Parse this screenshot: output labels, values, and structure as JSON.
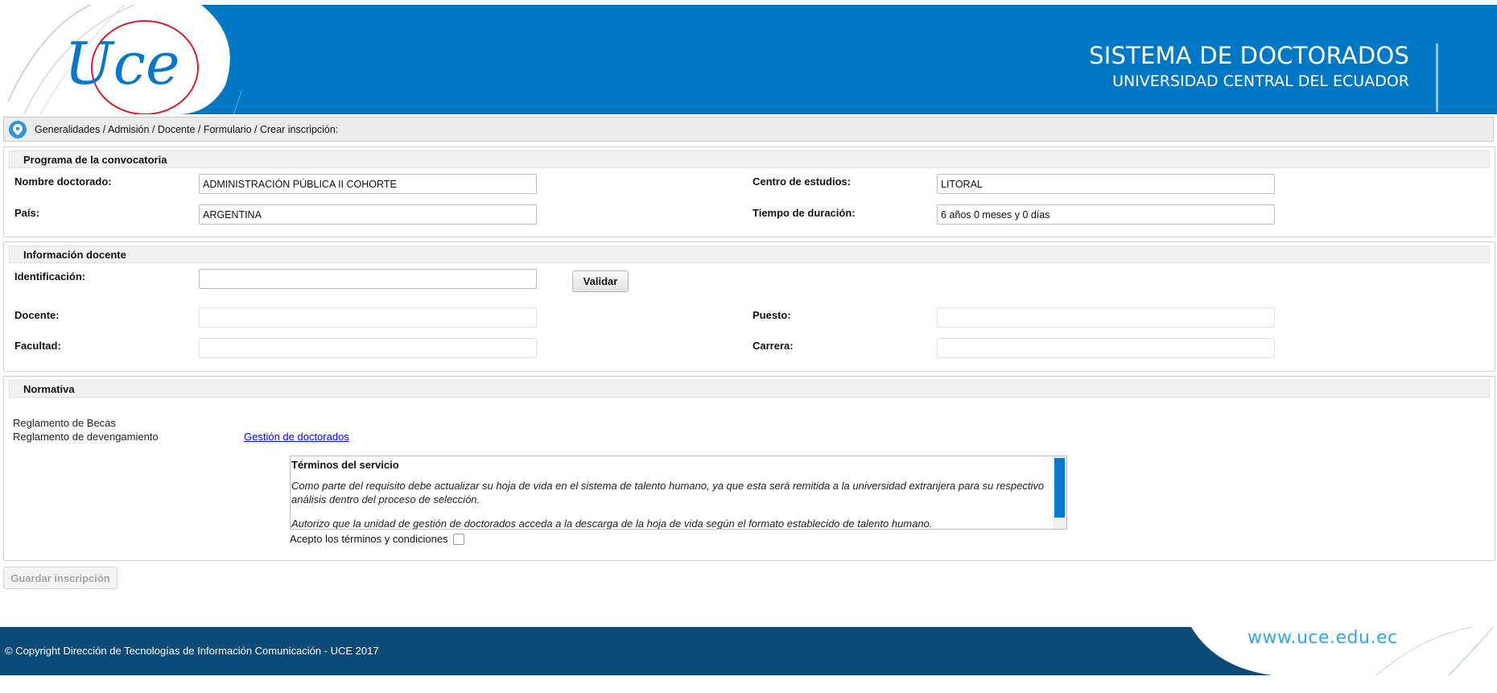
{
  "header": {
    "title": "SISTEMA DE DOCTORADOS",
    "subtitle": "UNIVERSIDAD CENTRAL DEL ECUADOR",
    "logo_text": "Uce"
  },
  "breadcrumb": {
    "icon": "location-pin-icon",
    "text": "Generalidades / Admisión / Docente / Formulario / Crear inscripción:"
  },
  "programa": {
    "heading": "Programa de la convocatoria",
    "nombre_label": "Nombre doctorado:",
    "nombre_value": "ADMINISTRACIÓN PÚBLICA II COHORTE",
    "pais_label": "País:",
    "pais_value": "ARGENTINA",
    "centro_label": "Centro de estudios:",
    "centro_value": "LITORAL",
    "tiempo_label": "Tiempo de duración:",
    "tiempo_value": "6 años 0 meses y 0 días"
  },
  "docente": {
    "heading": "Información docente",
    "id_label": "Identificación:",
    "id_value": "",
    "validar_label": "Validar",
    "docente_label": "Docente:",
    "docente_value": "",
    "facultad_label": "Facultad:",
    "facultad_value": "",
    "puesto_label": "Puesto:",
    "puesto_value": "",
    "carrera_label": "Carrera:",
    "carrera_value": ""
  },
  "normativa": {
    "heading": "Normativa",
    "reglamento_becas": "Reglamento de Becas",
    "reglamento_devengamiento": "Reglamento de devengamiento",
    "link_label": "Gestión de doctorados",
    "terms_title": "Términos del servicio",
    "terms_p1": "Como parte del requisito debe actualizar su hoja de vida en el sistema de talento humano, ya que esta será remitida a la universidad extranjera para su respectivo análisis dentro del proceso de selección.",
    "terms_p2": "Autorizo que la unidad de gestión de doctorados acceda a la descarga de la hoja de vida según el formato establecido de talento humano.",
    "accept_label": "Acepto los términos y condiciones",
    "accept_checked": false
  },
  "actions": {
    "save_label": "Guardar inscripción"
  },
  "footer": {
    "copyright": "© Copyright Dirección de Tecnologías de Información Comunicación - UCE 2017",
    "url": "www.uce.edu.ec"
  },
  "colors": {
    "header_blue": "#0077c2",
    "footer_navy": "#0c4a78",
    "link_blue": "#0000ee"
  }
}
